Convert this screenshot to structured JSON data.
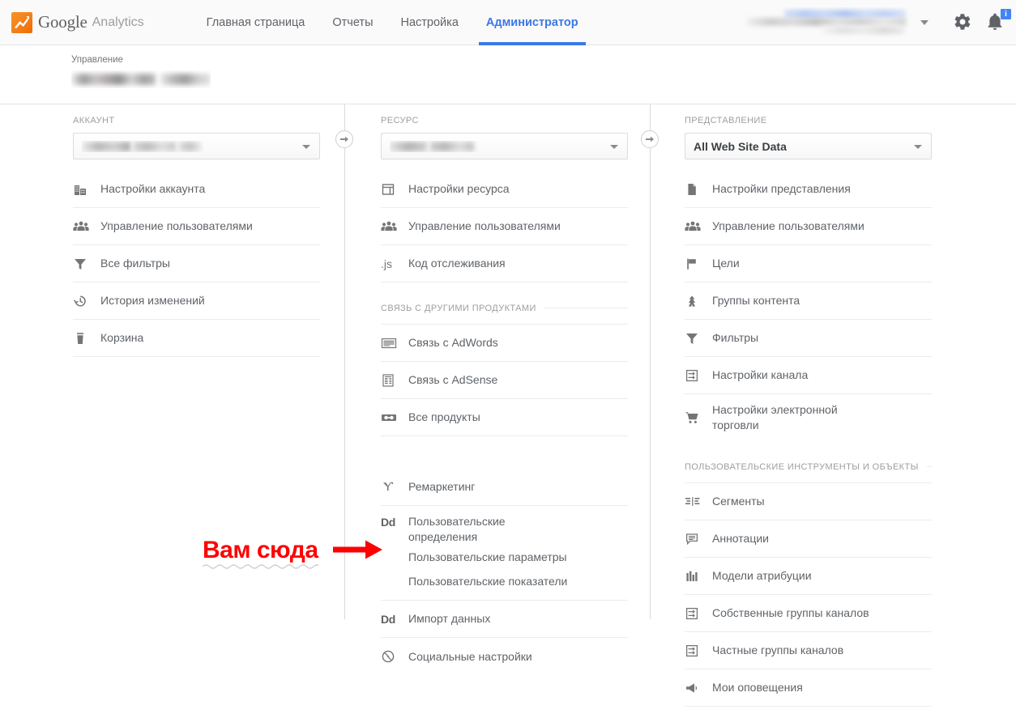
{
  "header": {
    "brand_google": "Google",
    "brand_analytics": "Analytics",
    "nav": [
      {
        "label": "Главная страница",
        "active": false
      },
      {
        "label": "Отчеты",
        "active": false
      },
      {
        "label": "Настройка",
        "active": false
      },
      {
        "label": "Администратор",
        "active": true
      }
    ],
    "notification_badge": "i",
    "accent_color": "#3b78e7",
    "logo_color": "#f4801e"
  },
  "breadcrumb": {
    "label": "Управление",
    "account_name_redacted": ""
  },
  "columns": {
    "account": {
      "head": "АККАУНТ",
      "selected_value": "",
      "items": [
        {
          "label": "Настройки аккаунта",
          "icon": "building-icon"
        },
        {
          "label": "Управление пользователями",
          "icon": "users-icon"
        },
        {
          "label": "Все фильтры",
          "icon": "funnel-icon"
        },
        {
          "label": "История изменений",
          "icon": "history-clock-icon"
        },
        {
          "label": "Корзина",
          "icon": "trash-icon"
        }
      ]
    },
    "property": {
      "head": "РЕСУРС",
      "selected_value": "",
      "items": [
        {
          "label": "Настройки ресурса",
          "icon": "page-layout-icon"
        },
        {
          "label": "Управление пользователями",
          "icon": "users-icon"
        },
        {
          "label": "Код отслеживания",
          "icon": "js-icon"
        }
      ],
      "section_linking": "СВЯЗЬ С ДРУГИМИ ПРОДУКТАМИ",
      "linking_items": [
        {
          "label": "Связь с AdWords",
          "icon": "adwords-icon"
        },
        {
          "label": "Связь с AdSense",
          "icon": "adsense-icon"
        },
        {
          "label": "Все продукты",
          "icon": "link-chain-icon"
        }
      ],
      "remarketing": {
        "label": "Ремаркетинг",
        "icon": "remarketing-y-icon"
      },
      "custom_definitions": {
        "label": "Пользовательские определения",
        "icon": "dd-icon",
        "sub_items": [
          "Пользовательские параметры",
          "Пользовательские показатели"
        ]
      },
      "data_import": {
        "label": "Импорт данных",
        "icon": "dd-icon"
      },
      "social_settings": {
        "label": "Социальные настройки",
        "icon": "globe-icon"
      }
    },
    "view": {
      "head": "ПРЕДСТАВЛЕНИЕ",
      "selected_value": "All Web Site Data",
      "items": [
        {
          "label": "Настройки представления",
          "icon": "document-icon"
        },
        {
          "label": "Управление пользователями",
          "icon": "users-icon"
        },
        {
          "label": "Цели",
          "icon": "flag-icon"
        },
        {
          "label": "Группы контента",
          "icon": "content-group-icon"
        },
        {
          "label": "Фильтры",
          "icon": "funnel-icon"
        },
        {
          "label": "Настройки канала",
          "icon": "channel-icon"
        },
        {
          "label": "Настройки электронной торговли",
          "icon": "cart-icon"
        }
      ],
      "section_tools": "ПОЛЬЗОВАТЕЛЬСКИЕ ИНСТРУМЕНТЫ И ОБЪЕКТЫ",
      "tool_items": [
        {
          "label": "Сегменты",
          "icon": "segments-icon"
        },
        {
          "label": "Аннотации",
          "icon": "annotation-icon"
        },
        {
          "label": "Модели атрибуции",
          "icon": "bar-chart-icon"
        },
        {
          "label": "Собственные группы каналов",
          "icon": "channel-icon"
        },
        {
          "label": "Частные группы каналов",
          "icon": "channel-icon"
        },
        {
          "label": "Мои оповещения",
          "icon": "megaphone-icon"
        }
      ]
    }
  },
  "annotation": {
    "text": "Вам сюда",
    "color": "#ff0000"
  }
}
